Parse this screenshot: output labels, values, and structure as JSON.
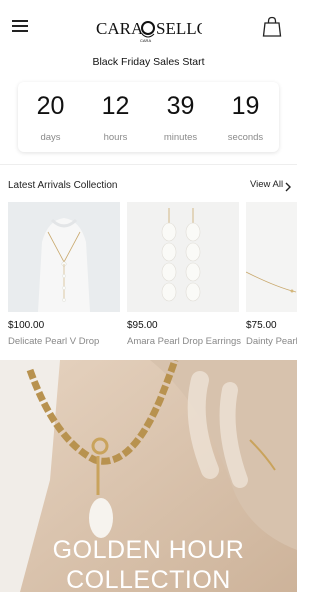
{
  "header": {
    "brand_left": "CARA",
    "brand_right": "SELLO",
    "brand_sub": "CARA"
  },
  "promo": {
    "title": "Black Friday Sales Start",
    "countdown": [
      {
        "value": "20",
        "label": "days"
      },
      {
        "value": "12",
        "label": "hours"
      },
      {
        "value": "39",
        "label": "minutes"
      },
      {
        "value": "19",
        "label": "seconds"
      }
    ]
  },
  "latest": {
    "title": "Latest Arrivals Collection",
    "view_all": "View All",
    "products": [
      {
        "price": "$100.00",
        "name": "Delicate Pearl V Drop"
      },
      {
        "price": "$95.00",
        "name": "Amara Pearl Drop Earrings"
      },
      {
        "price": "$75.00",
        "name": "Dainty Pearl S"
      }
    ]
  },
  "hero": {
    "line1": "GOLDEN HOUR",
    "line2": "COLLECTION"
  },
  "colors": {
    "text": "#111111",
    "muted": "#888888",
    "hero_text": "#ffffff"
  }
}
